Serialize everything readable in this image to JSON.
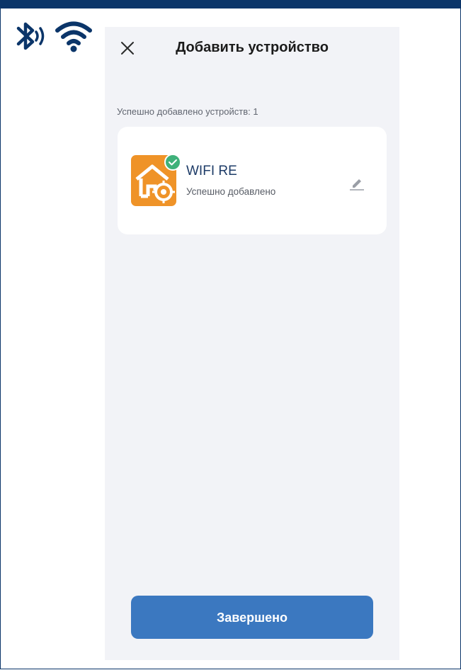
{
  "header": {
    "title": "Добавить устройство",
    "close_icon": "close-icon"
  },
  "summary": {
    "added_count_text": "Успешно добавлено устройств: 1"
  },
  "devices": [
    {
      "name": "WIFI RE",
      "status": "Успешно добавлено",
      "icon": "house-gear-icon",
      "badge": "check-icon",
      "edit_icon": "pencil-icon"
    }
  ],
  "footer": {
    "done_label": "Завершено"
  },
  "status_icons": [
    "bluetooth-icon",
    "wifi-icon"
  ],
  "colors": {
    "frame": "#0b3569",
    "background": "#f2f3f7",
    "card": "#ffffff",
    "device_icon": "#ef9328",
    "badge": "#3fb17a",
    "primary_button": "#3b78c0",
    "device_name": "#1e3c68"
  }
}
